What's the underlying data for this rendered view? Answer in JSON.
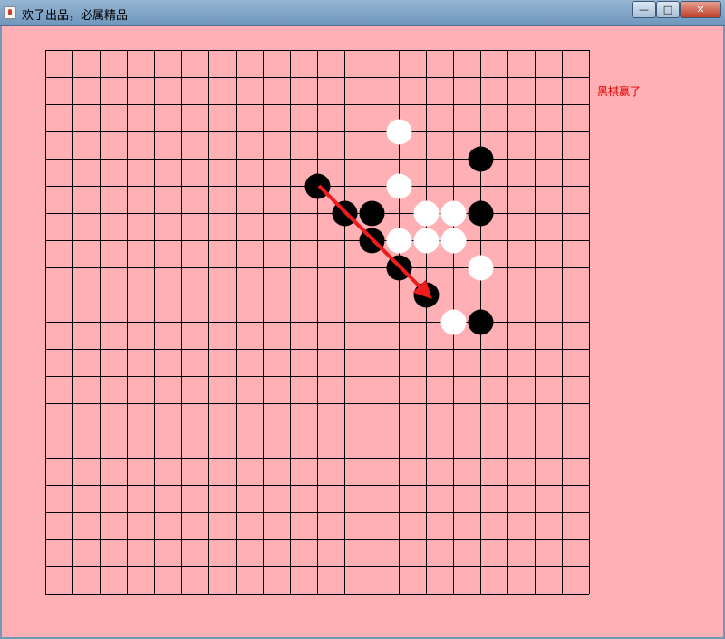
{
  "window": {
    "title": "欢子出品，必属精品",
    "minimize_glyph": "—",
    "maximize_glyph": "□",
    "close_glyph": "✕"
  },
  "status": {
    "message": "黑棋赢了",
    "color": "#e00000"
  },
  "board": {
    "lines": 21,
    "background": "#ffb0b4",
    "line_color": "#000000",
    "stones": [
      {
        "col": 13,
        "row": 3,
        "color": "white"
      },
      {
        "col": 16,
        "row": 4,
        "color": "black"
      },
      {
        "col": 10,
        "row": 5,
        "color": "black"
      },
      {
        "col": 13,
        "row": 5,
        "color": "white"
      },
      {
        "col": 11,
        "row": 6,
        "color": "black"
      },
      {
        "col": 12,
        "row": 6,
        "color": "black"
      },
      {
        "col": 14,
        "row": 6,
        "color": "white"
      },
      {
        "col": 15,
        "row": 6,
        "color": "white"
      },
      {
        "col": 16,
        "row": 6,
        "color": "black"
      },
      {
        "col": 12,
        "row": 7,
        "color": "black"
      },
      {
        "col": 13,
        "row": 7,
        "color": "white"
      },
      {
        "col": 14,
        "row": 7,
        "color": "white"
      },
      {
        "col": 15,
        "row": 7,
        "color": "white"
      },
      {
        "col": 13,
        "row": 8,
        "color": "black"
      },
      {
        "col": 16,
        "row": 8,
        "color": "white"
      },
      {
        "col": 14,
        "row": 9,
        "color": "black"
      },
      {
        "col": 15,
        "row": 10,
        "color": "white"
      },
      {
        "col": 16,
        "row": 10,
        "color": "black"
      }
    ],
    "winning_line": {
      "from": {
        "col": 10,
        "row": 5
      },
      "to": {
        "col": 14,
        "row": 9
      },
      "color": "#ee1c1c"
    }
  }
}
